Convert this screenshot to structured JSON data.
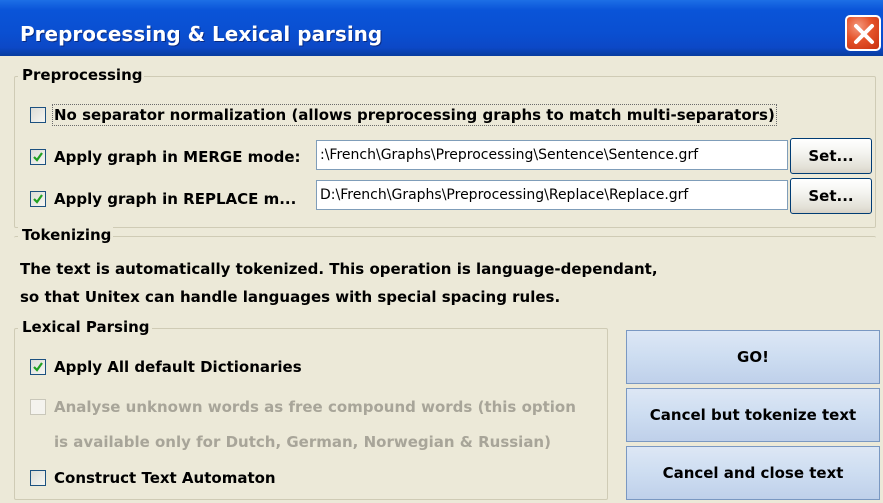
{
  "window": {
    "title": "Preprocessing & Lexical parsing"
  },
  "preprocessing": {
    "legend": "Preprocessing",
    "no_separator": {
      "label": "No separator normalization (allows preprocessing graphs to match multi-separators)",
      "checked": false
    },
    "merge": {
      "label": "Apply graph in MERGE mode:",
      "checked": true,
      "path": ":\\French\\Graphs\\Preprocessing\\Sentence\\Sentence.grf",
      "set_label": "Set..."
    },
    "replace": {
      "label": "Apply graph in REPLACE m...",
      "checked": true,
      "path": "D:\\French\\Graphs\\Preprocessing\\Replace\\Replace.grf",
      "set_label": "Set..."
    }
  },
  "tokenizing": {
    "legend": "Tokenizing",
    "line1": "The text is automatically tokenized. This operation is language-dependant,",
    "line2": "so that Unitex can handle languages with special spacing rules."
  },
  "lexical": {
    "legend": "Lexical Parsing",
    "apply_dicts": {
      "label": "Apply All default Dictionaries",
      "checked": true
    },
    "analyse_unknown": {
      "label": "Analyse unknown words as free compound words (this option",
      "label2": "is available only for Dutch, German, Norwegian & Russian)",
      "checked": false,
      "enabled": false
    },
    "construct_automaton": {
      "label": "Construct Text Automaton",
      "checked": false
    }
  },
  "buttons": {
    "go": "GO!",
    "cancel_tokenize": "Cancel but tokenize text",
    "cancel_close": "Cancel and close text"
  },
  "colors": {
    "titlebar": "#0a54d8",
    "dialog_bg": "#ece9d8",
    "close_button": "#e5532a"
  }
}
